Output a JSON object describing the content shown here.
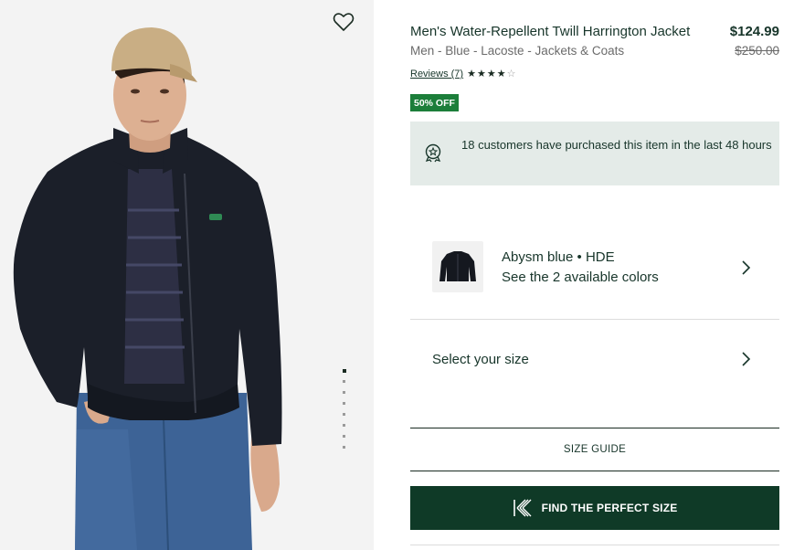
{
  "product": {
    "title": "Men's Water-Repellent Twill Harrington Jacket",
    "price": "$124.99",
    "breadcrumb": "Men - Blue - Lacoste - Jackets & Coats",
    "old_price": "$250.00",
    "reviews_label": "Reviews (7)",
    "rating": 4,
    "rating_max": 5,
    "discount_badge": "50% OFF"
  },
  "notice": {
    "text": "18 customers have purchased this item in the last 48 hours",
    "icon": "award-badge-icon"
  },
  "color": {
    "name": "Abysm blue • HDE",
    "link": "See the 2 available colors"
  },
  "size": {
    "label": "Select your size",
    "guide_label": "SIZE GUIDE",
    "finder_label": "FIND THE PERFECT SIZE"
  },
  "gallery": {
    "image_count": 8,
    "active_index": 0
  },
  "colors": {
    "primary": "#0f3a27",
    "badge": "#1c7e3a",
    "notice_bg": "#e4ebe8"
  }
}
